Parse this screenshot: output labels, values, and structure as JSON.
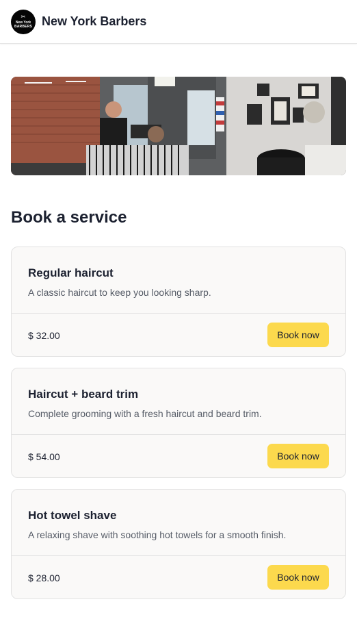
{
  "header": {
    "brand": "New York Barbers",
    "logo": {
      "icon": "scissors-icon",
      "line1": "New York",
      "line2": "BARBERS"
    }
  },
  "hero": {
    "alt": "Barbershop interior"
  },
  "section_title": "Book a service",
  "services": [
    {
      "title": "Regular haircut",
      "description": "A classic haircut to keep you looking sharp.",
      "price": "$ 32.00",
      "button": "Book now"
    },
    {
      "title": "Haircut + beard trim",
      "description": "Complete grooming with a fresh haircut and beard trim.",
      "price": "$ 54.00",
      "button": "Book now"
    },
    {
      "title": "Hot towel shave",
      "description": "A relaxing shave with soothing hot towels for a smooth finish.",
      "price": "$ 28.00",
      "button": "Book now"
    }
  ],
  "colors": {
    "accent": "#fcd94d",
    "text": "#1c2130",
    "muted": "#555b66",
    "card_bg": "#faf9f8"
  }
}
